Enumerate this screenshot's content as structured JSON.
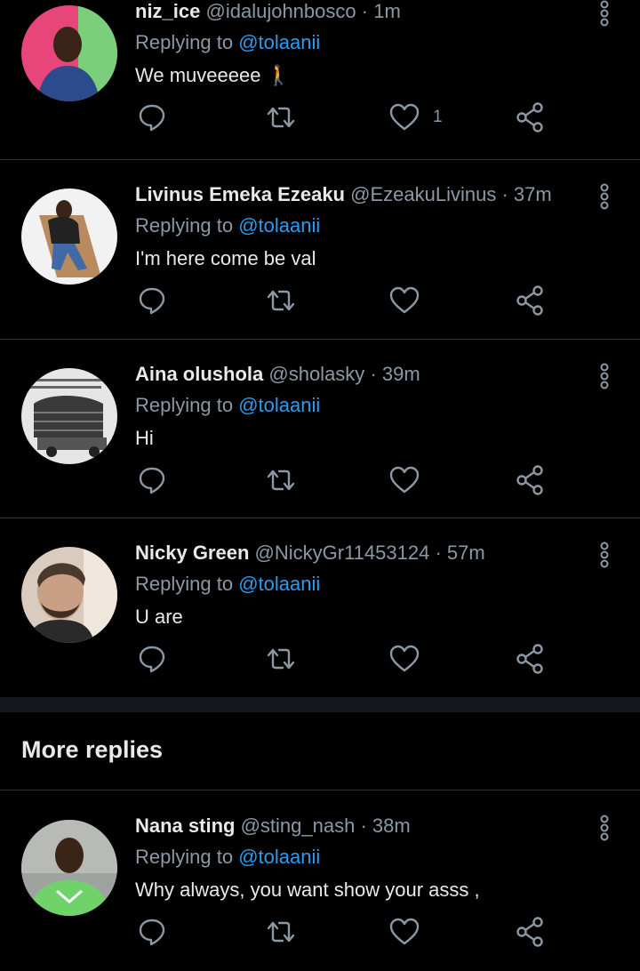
{
  "tweets": [
    {
      "name": "niz_ice",
      "handle": "@idalujohnbosco",
      "separator": "·",
      "time": "1m",
      "replying_label": "Replying to",
      "mention": "@tolaanii",
      "text": "We muveeeee 🚶",
      "like_count": "1",
      "avatar_bg": "#e8457a"
    },
    {
      "name": "Livinus Emeka Ezeaku",
      "handle": "@EzeakuLivinus",
      "separator": "·",
      "time": "37m",
      "replying_label": "Replying to",
      "mention": "@tolaanii",
      "text": "I'm here come be val",
      "like_count": "",
      "avatar_bg": "#f2f2f2"
    },
    {
      "name": "Aina olushola",
      "handle": "@sholasky",
      "separator": "·",
      "time": "39m",
      "replying_label": "Replying to",
      "mention": "@tolaanii",
      "text": "Hi",
      "like_count": "",
      "avatar_bg": "#e6e6e6"
    },
    {
      "name": "Nicky Green",
      "handle": "@NickyGr11453124",
      "separator": "·",
      "time": "57m",
      "replying_label": "Replying to",
      "mention": "@tolaanii",
      "text": "U are",
      "like_count": "",
      "avatar_bg": "#d9cbbe"
    },
    {
      "name": "Nana sting",
      "handle": "@sting_nash",
      "separator": "·",
      "time": "38m",
      "replying_label": "Replying to",
      "mention": "@tolaanii",
      "text": "Why always, you want show your asss ,",
      "like_count": "",
      "avatar_bg": "#9fa3a0"
    }
  ],
  "section": {
    "title": "More replies"
  },
  "icons": {
    "reply": "reply-icon",
    "retweet": "retweet-icon",
    "like": "heart-icon",
    "share": "share-icon",
    "more": "more-vertical-icon"
  },
  "colors": {
    "background": "#000000",
    "mention": "#2b9cf0",
    "secondary_text": "#8b98a5",
    "primary_text": "#e7e9ea",
    "divider": "#2f3336"
  }
}
